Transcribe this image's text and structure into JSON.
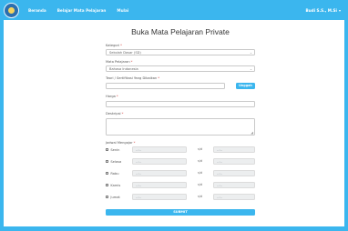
{
  "colors": {
    "accent": "#3bb6ee",
    "required": "#d9534f"
  },
  "navbar": {
    "logo_icon": "logo-icon",
    "links": [
      "Beranda",
      "Belajar Mata Pelajaran",
      "Mulai"
    ],
    "user_label": "Budi S.S., M.Si"
  },
  "page": {
    "title": "Buka Mata Pelajaran Private"
  },
  "form": {
    "kategori": {
      "label": "Kategori",
      "value": "Sekolah Dasar (SD)"
    },
    "mapel": {
      "label": "Mata Pelajaran",
      "value": "Bahasa Indonesia"
    },
    "sertifikat": {
      "label": "Teori / Sertifikasi Yang Dibaikan",
      "value": "",
      "upload_label": "Unggah"
    },
    "harga": {
      "label": "Harga",
      "value": ""
    },
    "deskripsi": {
      "label": "Deskripsi",
      "value": ""
    },
    "jadwal": {
      "label": "Jadwal Mengajar",
      "sep": "s/d",
      "time_placeholder": "--:--",
      "days": [
        "Senin",
        "Selasa",
        "Rabu",
        "Kamis",
        "Jumat"
      ]
    },
    "submit_label": "SUBMIT"
  }
}
